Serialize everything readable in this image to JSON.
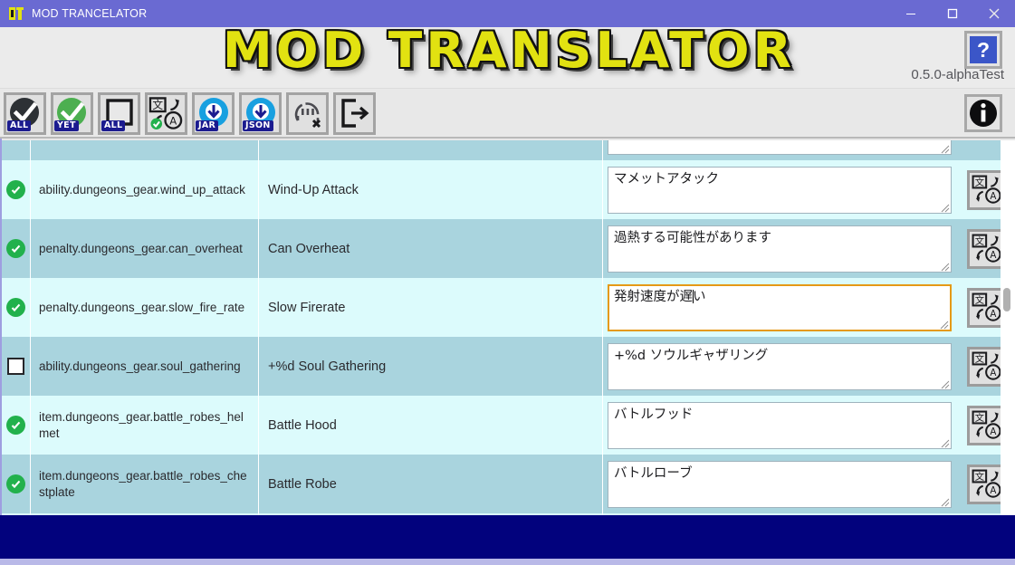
{
  "window": {
    "title": "MOD TRANCELATOR",
    "app_icon": "mt-logo-icon",
    "minimize_label": "Minimize",
    "maximize_label": "Maximize",
    "close_label": "Close"
  },
  "header": {
    "logo_text": "MOD TRANSLATOR",
    "version": "0.5.0-alphaTest",
    "help_label": "?",
    "info_label": "i"
  },
  "toolbar": {
    "buttons": [
      {
        "name": "select-all-button",
        "badge": "ALL",
        "icon": "dark-circle-check-icon"
      },
      {
        "name": "select-untranslated-button",
        "badge": "YET",
        "icon": "green-circle-check-icon"
      },
      {
        "name": "deselect-all-button",
        "badge": "ALL",
        "icon": "empty-square-icon"
      },
      {
        "name": "translate-selected-button",
        "badge": "",
        "icon": "translate-check-icon"
      },
      {
        "name": "export-jar-button",
        "badge": "JAR",
        "icon": "download-circle-icon"
      },
      {
        "name": "export-json-button",
        "badge": "JSON",
        "icon": "download-circle-icon"
      },
      {
        "name": "clear-cache-button",
        "badge": "",
        "icon": "clear-bubble-x-icon"
      },
      {
        "name": "exit-button",
        "badge": "",
        "icon": "exit-arrow-icon"
      }
    ]
  },
  "table": {
    "row_action_icon": "translate-icon",
    "rows": [
      {
        "checked": true,
        "key": "",
        "source": "",
        "translation": "",
        "focused": false,
        "partial": true
      },
      {
        "checked": true,
        "key": "ability.dungeons_gear.wind_up_attack",
        "source": "Wind-Up Attack",
        "translation": "マメットアタック",
        "focused": false
      },
      {
        "checked": true,
        "key": "penalty.dungeons_gear.can_overheat",
        "source": "Can Overheat",
        "translation": "過熱する可能性があります",
        "focused": false
      },
      {
        "checked": true,
        "key": "penalty.dungeons_gear.slow_fire_rate",
        "source": "Slow Firerate",
        "translation": "発射速度が遅い",
        "focused": true,
        "caret_after": 6
      },
      {
        "checked": false,
        "key": "ability.dungeons_gear.soul_gathering",
        "source": "+%d Soul Gathering",
        "translation": "+%d ソウルギャザリング",
        "focused": false
      },
      {
        "checked": true,
        "key": "item.dungeons_gear.battle_robes_helmet",
        "source": "Battle Hood",
        "translation": "バトルフッド",
        "focused": false
      },
      {
        "checked": true,
        "key": "item.dungeons_gear.battle_robes_chestplate",
        "source": "Battle Robe",
        "translation": "バトルローブ",
        "focused": false
      },
      {
        "checked": true,
        "key": "",
        "source": "",
        "translation": "",
        "focused": false,
        "partial": true
      }
    ]
  },
  "statusbar": {
    "text": ""
  },
  "colors": {
    "titlebar": "#6a6ad2",
    "logo_yellow": "#e2e211",
    "row_odd": "#a9d4de",
    "row_even": "#dcfbfc",
    "check_green": "#22b14c",
    "focus_orange": "#e59a17",
    "status_navy": "#02027d",
    "badge_navy": "#1b1b8f",
    "help_blue": "#3b56c8"
  }
}
